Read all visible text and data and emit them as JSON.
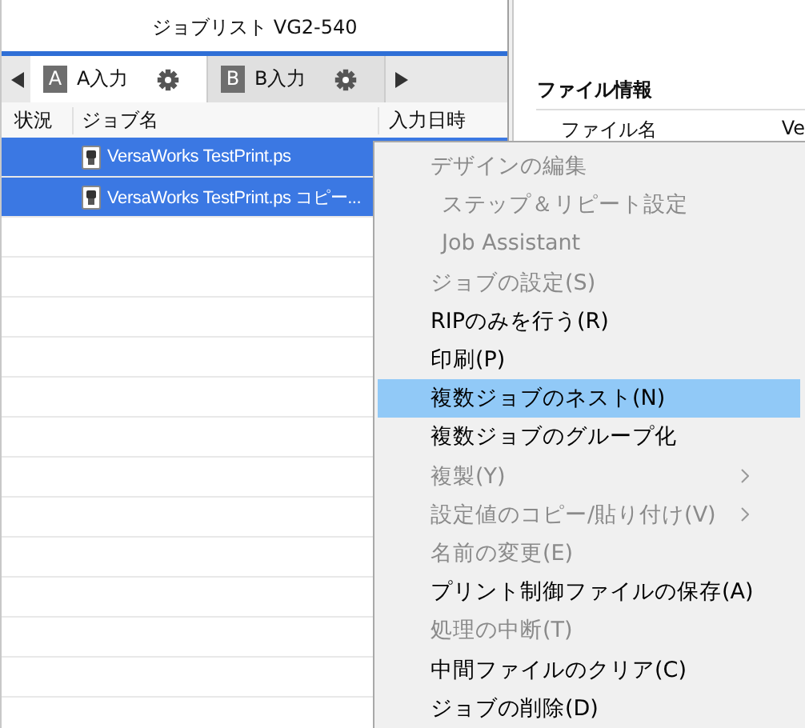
{
  "job_list": {
    "title": "ジョブリスト VG2-540",
    "tabs": [
      {
        "badge": "A",
        "label": "A入力",
        "selected": true
      },
      {
        "badge": "B",
        "label": "B入力",
        "selected": false
      }
    ],
    "columns": [
      "状況",
      "ジョブ名",
      "入力日時"
    ],
    "rows": [
      {
        "name": "VersaWorks TestPrint.ps",
        "selected": true
      },
      {
        "name": "VersaWorks TestPrint.ps コピー...",
        "selected": true
      }
    ]
  },
  "file_info": {
    "title": "ファイル情報",
    "field_label": "ファイル名",
    "field_value": "Ve"
  },
  "context_menu": {
    "items": [
      {
        "label": "デザインの編集",
        "disabled": true,
        "indented": false,
        "submenu": false,
        "selected": false
      },
      {
        "label": "ステップ＆リピート設定",
        "disabled": true,
        "indented": true,
        "submenu": false,
        "selected": false
      },
      {
        "label": "Job Assistant",
        "disabled": true,
        "indented": true,
        "submenu": false,
        "selected": false
      },
      {
        "label": "ジョブの設定(S)",
        "disabled": true,
        "indented": false,
        "submenu": false,
        "selected": false
      },
      {
        "label": "RIPのみを行う(R)",
        "disabled": false,
        "indented": false,
        "submenu": false,
        "selected": false
      },
      {
        "label": "印刷(P)",
        "disabled": false,
        "indented": false,
        "submenu": false,
        "selected": false
      },
      {
        "label": "複数ジョブのネスト(N)",
        "disabled": false,
        "indented": false,
        "submenu": false,
        "selected": true
      },
      {
        "label": "複数ジョブのグループ化",
        "disabled": false,
        "indented": false,
        "submenu": false,
        "selected": false
      },
      {
        "label": "複製(Y)",
        "disabled": true,
        "indented": false,
        "submenu": true,
        "selected": false
      },
      {
        "label": "設定値のコピー/貼り付け(V)",
        "disabled": true,
        "indented": false,
        "submenu": true,
        "selected": false
      },
      {
        "label": "名前の変更(E)",
        "disabled": true,
        "indented": false,
        "submenu": false,
        "selected": false
      },
      {
        "label": "プリント制御ファイルの保存(A)",
        "disabled": false,
        "indented": false,
        "submenu": false,
        "selected": false
      },
      {
        "label": "処理の中断(T)",
        "disabled": true,
        "indented": false,
        "submenu": false,
        "selected": false
      },
      {
        "label": "中間ファイルのクリア(C)",
        "disabled": false,
        "indented": false,
        "submenu": false,
        "selected": false
      },
      {
        "label": "ジョブの削除(D)",
        "disabled": false,
        "indented": false,
        "submenu": false,
        "selected": false
      }
    ]
  }
}
